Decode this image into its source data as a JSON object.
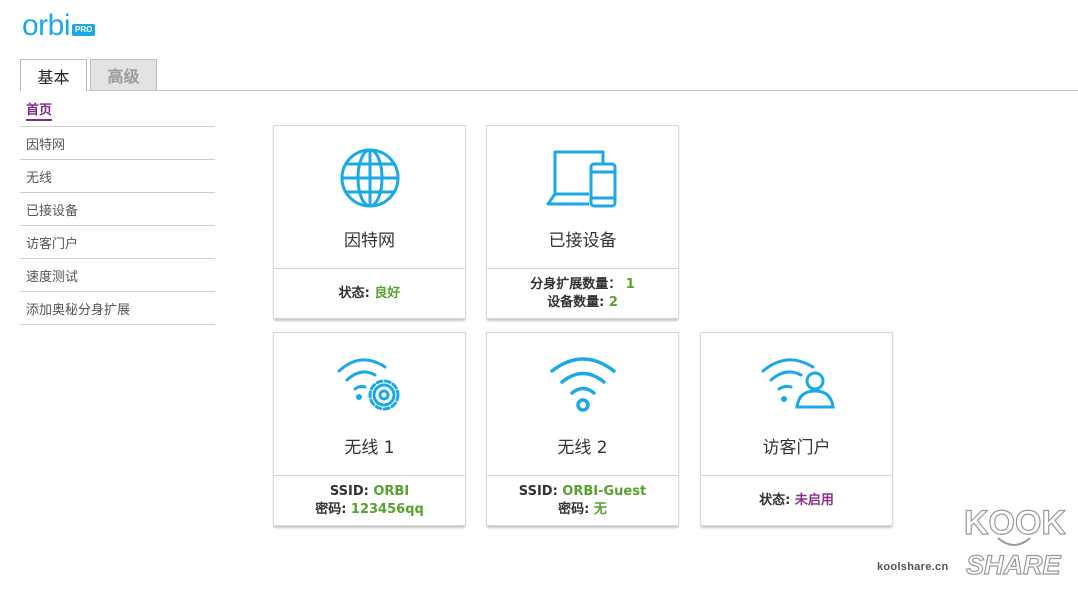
{
  "logo": {
    "text": "orbi",
    "badge": "PRO"
  },
  "tabs": [
    {
      "label": "基本",
      "active": true
    },
    {
      "label": "高级",
      "active": false
    }
  ],
  "sidebar": {
    "items": [
      {
        "label": "首页",
        "active": true
      },
      {
        "label": "因特网"
      },
      {
        "label": "无线"
      },
      {
        "label": "已接设备"
      },
      {
        "label": "访客门户"
      },
      {
        "label": "速度测试"
      },
      {
        "label": "添加奥秘分身扩展"
      }
    ]
  },
  "cards": {
    "internet": {
      "icon": "globe-icon",
      "title": "因特网",
      "status_label": "状态:",
      "status_value": "良好"
    },
    "devices": {
      "icon": "laptop-phone-icon",
      "title": "已接设备",
      "satellites_label": "分身扩展数量：",
      "satellites_value": "1",
      "devices_label": "设备数量:",
      "devices_value": "2"
    },
    "wireless1": {
      "icon": "wifi-gear-icon",
      "title": "无线 1",
      "ssid_label": "SSID:",
      "ssid_value": "ORBI",
      "password_label": "密码:",
      "password_value": "123456qq"
    },
    "wireless2": {
      "icon": "wifi-icon",
      "title": "无线 2",
      "ssid_label": "SSID:",
      "ssid_value": "ORBI-Guest",
      "password_label": "密码:",
      "password_value": "无"
    },
    "guest": {
      "icon": "wifi-user-icon",
      "title": "访客门户",
      "status_label": "状态:",
      "status_value": "未启用"
    }
  },
  "watermark": {
    "url": "koolshare.cn",
    "brand_top": "KOOK",
    "brand_bottom": "SHARE"
  },
  "colors": {
    "brand_blue": "#1aa9e6",
    "status_green": "#58a12c",
    "accent_purple": "#8a2f8f"
  }
}
